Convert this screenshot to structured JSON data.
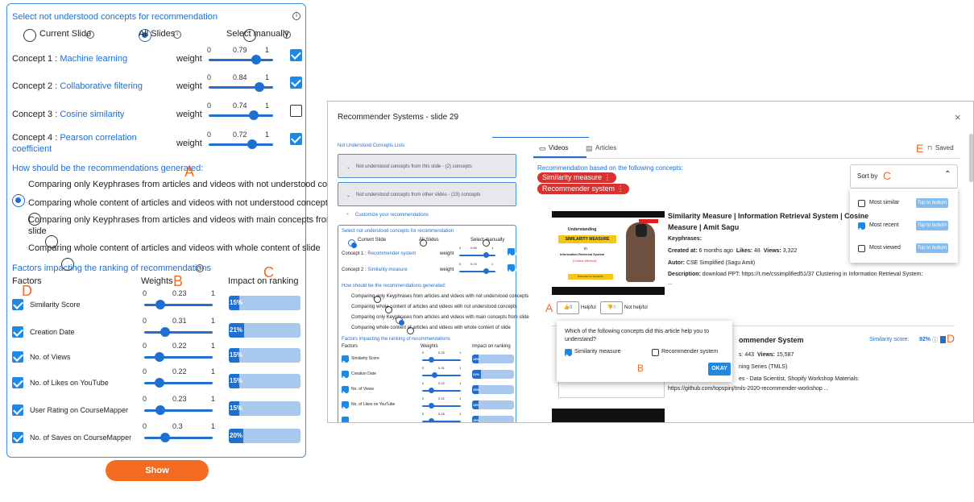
{
  "left": {
    "select_title": "Select not understood concepts for recommendation",
    "radios": [
      "Current Slide",
      "All Slides",
      "Select manually"
    ],
    "concepts": [
      {
        "prefix": "Concept 1 : ",
        "name": "Machine learning",
        "weight_label": "weight",
        "min": "0",
        "value": "0.79",
        "max": "1",
        "checked": true
      },
      {
        "prefix": "Concept 2 : ",
        "name": "Collaborative filtering",
        "weight_label": "weight",
        "min": "0",
        "value": "0.84",
        "max": "1",
        "checked": true
      },
      {
        "prefix": "Concept 3 : ",
        "name": "Cosine similarity",
        "weight_label": "weight",
        "min": "0",
        "value": "0.74",
        "max": "1",
        "checked": false
      },
      {
        "prefix": "Concept 4 : ",
        "name": "Pearson correlation",
        "name2": "coefficient",
        "weight_label": "weight",
        "min": "0",
        "value": "0.72",
        "max": "1",
        "checked": true
      }
    ],
    "how_title": "How should be the recommendations generated:",
    "how_options": [
      "Comparing only Keyphrases from articles and videos with not understood concepts",
      "Comparing whole content of articles and videos with not understood concepts",
      "Comparing only Keyphrases from articles and videos with main concepts from",
      "slide",
      "Comparing whole content of articles and videos with whole content of slide"
    ],
    "factors_title": "Factors impacting the ranking of recommendations",
    "col_factors": "Factors",
    "col_weights": "Weights",
    "col_impact": "Impact on ranking",
    "factors": [
      {
        "name": "Similarity Score",
        "min": "0",
        "value": "0.23",
        "max": "1",
        "impact": "15%",
        "impact_pct": 15
      },
      {
        "name": "Creation Date",
        "min": "0",
        "value": "0.31",
        "max": "1",
        "impact": "21%",
        "impact_pct": 21
      },
      {
        "name": "No. of Views",
        "min": "0",
        "value": "0.22",
        "max": "1",
        "impact": "15%",
        "impact_pct": 15
      },
      {
        "name": "No. of Likes on YouTube",
        "min": "0",
        "value": "0.22",
        "max": "1",
        "impact": "15%",
        "impact_pct": 15
      },
      {
        "name": "User Rating on CourseMapper",
        "min": "0",
        "value": "0.23",
        "max": "1",
        "impact": "15%",
        "impact_pct": 15
      },
      {
        "name": "No. of Saves on CourseMapper",
        "min": "0",
        "value": "0.3",
        "max": "1",
        "impact": "20%",
        "impact_pct": 20
      }
    ],
    "show_button": "Show Recommendations",
    "labels": {
      "A": "A",
      "B": "B",
      "C": "C",
      "D": "D"
    }
  },
  "modal": {
    "title": "Recommender Systems - slide 29",
    "close": "×",
    "side": {
      "lists_title": "Not Understood Concepts Lists",
      "panel1": "Not understood concepts from this slide - (2) concepts",
      "panel2": "Not understood concepts from other slides - (23) concepts",
      "customize": "Customize your recommendations",
      "select_title": "Select not understood concepts for recommendation",
      "radios": [
        "Current Slide",
        "All Slides",
        "Select manually"
      ],
      "concept1_prefix": "Concept 1 : ",
      "concept1": "Recommender system",
      "concept2_prefix": "Concept 2 : ",
      "concept2": "Similarity measure",
      "weight": "weight",
      "c1": {
        "min": "0",
        "value": "0.69",
        "max": "1"
      },
      "c2": {
        "min": "0",
        "value": "0.74",
        "max": "1"
      },
      "how_title": "How should be the recommendations generated:",
      "how_options": [
        "Comparing only Keyphrases from articles and videos with not understood concepts",
        "Comparing whole content of articles and videos with not understood concepts",
        "Comparing only Keyphrases from articles and videos with main concepts from slide",
        "Comparing whole content of articles and videos with whole content of slide"
      ],
      "factors_title": "Factors impacting the ranking of recommendations",
      "col_factors": "Factors",
      "col_weights": "Weights",
      "col_impact": "Impact on ranking",
      "factors": [
        {
          "name": "Similarity Score",
          "min": "0",
          "value": "0.23",
          "max": "1",
          "impact": "15%"
        },
        {
          "name": "Creation Date",
          "min": "0",
          "value": "0.31",
          "max": "1",
          "impact": "21%"
        },
        {
          "name": "No. of Views",
          "min": "0",
          "value": "0.22",
          "max": "1",
          "impact": "15%"
        },
        {
          "name": "No. of Likes on YouTube",
          "min": "0",
          "value": "0.22",
          "max": "1",
          "impact": "15%"
        },
        {
          "name": "",
          "min": "0",
          "value": "0.23",
          "max": "1",
          "impact": "15%"
        }
      ]
    },
    "tabs": [
      "Videos",
      "Articles"
    ],
    "saved": "Saved",
    "based_on": "Recommendation based on the following concepts:",
    "chips": [
      "Similarity measure",
      "Recommender system"
    ],
    "sort": {
      "label": "Sort by",
      "options": [
        {
          "label": "Most similar",
          "checked": false,
          "btn": "Top to bottom"
        },
        {
          "label": "Most recent",
          "checked": true,
          "btn": "Top to bottom"
        },
        {
          "label": "Most viewed",
          "checked": false,
          "btn": "Top to bottom"
        }
      ]
    },
    "video1": {
      "thumb_line1": "Understanding",
      "thumb_line2": "SIMILARITY MEASURE",
      "thumb_line3": "in",
      "thumb_line4": "Information Retrieval System",
      "thumb_line5": "(Cosine Method)",
      "thumb_badge": "Subscribe for Simplicity!",
      "title": "Similarity Measure | Information Retrieval System | Cosine",
      "title2": "Measure | Amit Sagu",
      "keyphrases": "Keyphrases:",
      "created_label": "Created at:",
      "created": "6 months ago",
      "likes_label": "Likes:",
      "likes": "48",
      "views_label": "Views:",
      "views": "3,322",
      "author_label": "Autor:",
      "author": "CSE Simplified (Sagu Amit)",
      "desc_label": "Description:",
      "desc": "download PPT: https://t.me/cssimplified51/37 Clustering in Information Retrieval System:",
      "desc2": "..."
    },
    "feedback": {
      "likes": "0",
      "helpful": "Helpful",
      "dislikes": "0",
      "not_helpful": "Not helpful"
    },
    "popup": {
      "question": "Which of the following concepts did this article help you to",
      "question2": "understand?",
      "opt1": "Similarity measure",
      "opt2": "Recommender system",
      "okay": "OKAY"
    },
    "video2": {
      "title_frag": "ommender System",
      "sim": "Similarity score:",
      "sim_val": "92%",
      "stats_frag": "s: 443",
      "views_label": "Views:",
      "views": "15,587",
      "line3": "ning Series (TMLS)",
      "line4": "es - Data Scientist, Shopify Workshop Materials:",
      "line5": "https://github.com/topspinj/tmls-2020-recommender-workshop ..."
    },
    "labels": {
      "A": "A",
      "B": "B",
      "C": "C",
      "D": "D",
      "E": "E"
    }
  }
}
